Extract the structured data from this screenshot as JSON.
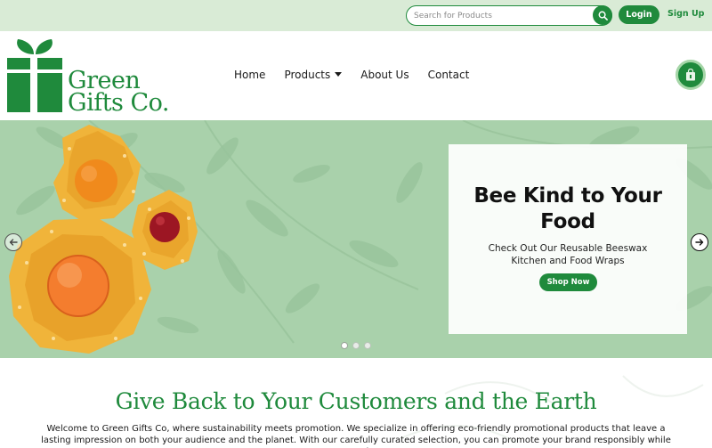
{
  "topbar": {
    "search_placeholder": "Search for Products",
    "login_label": "Login",
    "signup_label": "Sign Up"
  },
  "header": {
    "logo_line1": "Green",
    "logo_line2": "Gifts Co.",
    "nav": {
      "home": "Home",
      "products": "Products",
      "about": "About Us",
      "contact": "Contact"
    },
    "icons": {
      "cart": "shopping-bag-icon",
      "search": "search-icon",
      "dropdown": "caret-down-icon"
    }
  },
  "hero": {
    "title": "Bee Kind to Your Food",
    "subtitle": "Check Out Our Reusable Beeswax Kitchen and Food Wraps",
    "cta_label": "Shop Now",
    "slide_count": 3,
    "active_slide": 1
  },
  "intro": {
    "title": "Give Back to Your Customers and the Earth",
    "body": "Welcome to Green Gifts Co, where sustainability meets promotion. We specialize in offering eco-friendly promotional products that leave a lasting impression on both your audience and the planet. With our carefully curated selection, you can promote your brand responsibly while supporting"
  },
  "colors": {
    "brand_green": "#1f8a3c",
    "topbar_bg": "#d9ebd6",
    "hero_bg": "#a9d1ab",
    "wrap_yellow": "#f0b43a"
  }
}
